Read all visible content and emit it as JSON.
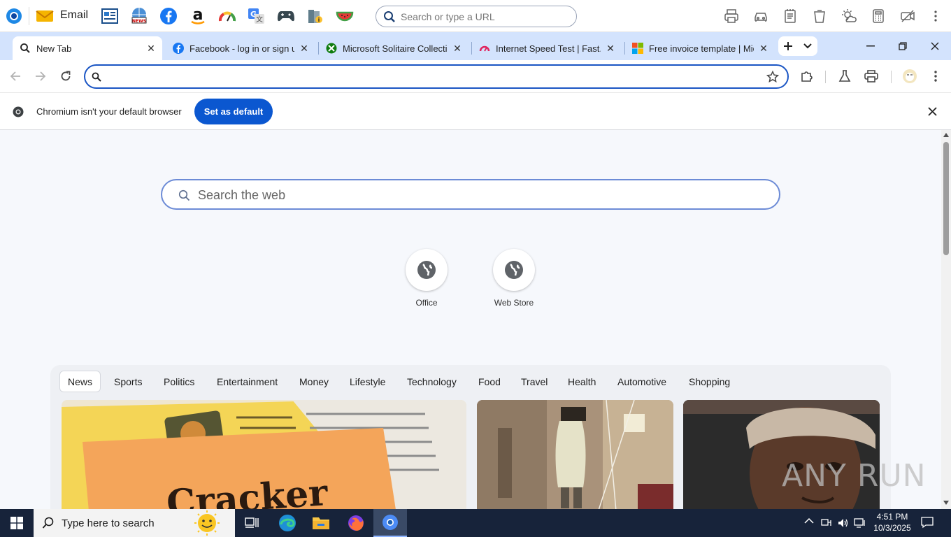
{
  "appbar": {
    "email_label": "Email",
    "search_placeholder": "Search or type a URL"
  },
  "tabs": [
    {
      "title": "New Tab",
      "icon": "search-icon"
    },
    {
      "title": "Facebook - log in or sign up",
      "icon": "facebook-icon"
    },
    {
      "title": "Microsoft Solitaire Collection",
      "icon": "xbox-icon"
    },
    {
      "title": "Internet Speed Test | Fast.com",
      "icon": "speed-gauge-icon"
    },
    {
      "title": "Free invoice template | Microsoft",
      "icon": "microsoft-logo-icon"
    }
  ],
  "infobar": {
    "message": "Chromium isn't your default browser",
    "button": "Set as default"
  },
  "ntp": {
    "search_placeholder": "Search the web",
    "shortcuts": [
      {
        "label": "Office"
      },
      {
        "label": "Web Store"
      }
    ],
    "categories": [
      "News",
      "Sports",
      "Politics",
      "Entertainment",
      "Money",
      "Lifestyle",
      "Technology",
      "Food",
      "Travel",
      "Health",
      "Automotive",
      "Shopping"
    ],
    "active_category": "News",
    "card_text": "Cracker"
  },
  "taskbar": {
    "search_placeholder": "Type here to search",
    "time": "4:51 PM",
    "date": "10/3/2025"
  },
  "watermark": "ANY RUN",
  "colors": {
    "accent": "#0b57d0",
    "tabstrip": "#d3e3fd",
    "taskbar": "#17233a"
  }
}
